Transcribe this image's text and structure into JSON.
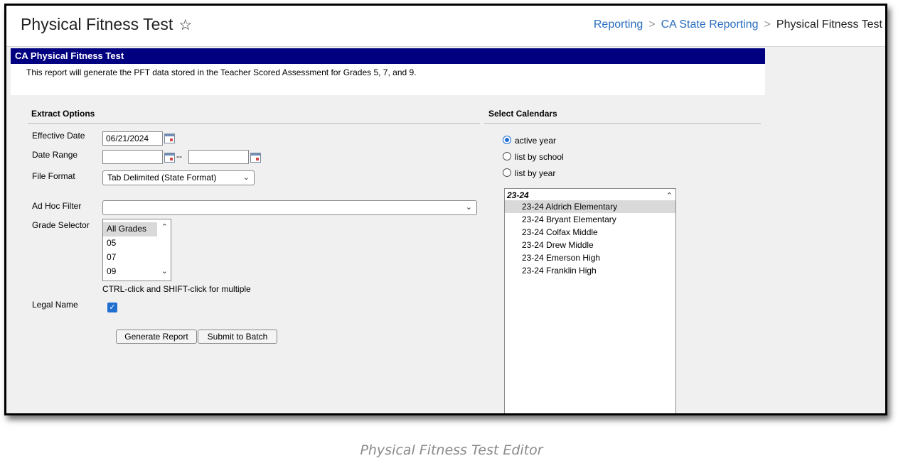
{
  "header": {
    "title": "Physical Fitness Test",
    "breadcrumb": [
      "Reporting",
      "CA State Reporting",
      "Physical Fitness Test"
    ]
  },
  "panel": {
    "title": "CA Physical Fitness Test",
    "description": "This report will generate the PFT data stored in the Teacher Scored Assessment for Grades 5, 7, and 9."
  },
  "extract": {
    "heading": "Extract Options",
    "effective_date_label": "Effective Date",
    "effective_date_value": "06/21/2024",
    "date_range_label": "Date Range",
    "date_range_sep": "--",
    "file_format_label": "File Format",
    "file_format_value": "Tab Delimited (State Format)",
    "adhoc_label": "Ad Hoc Filter",
    "adhoc_value": "",
    "grade_label": "Grade Selector",
    "grades": [
      "All Grades",
      "05",
      "07",
      "09"
    ],
    "grade_hint": "CTRL-click and SHIFT-click for multiple",
    "legal_name_label": "Legal Name",
    "legal_name_checked": true,
    "generate_label": "Generate Report",
    "submit_label": "Submit to Batch"
  },
  "calendars": {
    "heading": "Select Calendars",
    "modes": [
      "active year",
      "list by school",
      "list by year"
    ],
    "selected_mode": "active year",
    "group": "23-24",
    "items": [
      "23-24 Aldrich Elementary",
      "23-24 Bryant Elementary",
      "23-24 Colfax Middle",
      "23-24 Drew Middle",
      "23-24 Emerson High",
      "23-24 Franklin High"
    ]
  },
  "caption": "Physical Fitness Test Editor",
  "colors": {
    "panel_header": "#000080",
    "link": "#2a6ebf",
    "check": "#1f6fd1"
  }
}
